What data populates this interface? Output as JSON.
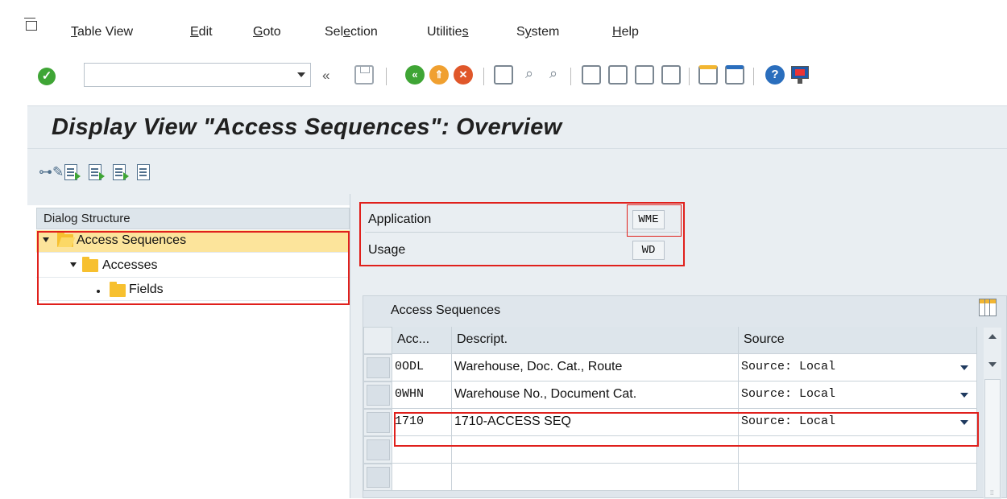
{
  "menu": {
    "items": [
      {
        "id": "table-view",
        "underline": "T",
        "rest": "able View"
      },
      {
        "id": "edit",
        "underline": "E",
        "rest": "dit"
      },
      {
        "id": "goto",
        "underline": "G",
        "rest": "oto"
      },
      {
        "id": "selection",
        "pre": "Sel",
        "underline": "e",
        "rest": "ction"
      },
      {
        "id": "utilities",
        "pre": "Utilitie",
        "underline": "s",
        "rest": ""
      },
      {
        "id": "system",
        "pre": "S",
        "underline": "y",
        "rest": "stem"
      },
      {
        "id": "help",
        "underline": "H",
        "rest": "elp"
      }
    ]
  },
  "toolbar": {
    "command_field": {
      "value": "",
      "placeholder": ""
    },
    "icons": [
      "enter-icon",
      "save-icon",
      "back-icon",
      "exit-icon",
      "cancel-icon",
      "print-icon",
      "find-icon",
      "find-next-icon",
      "first-page-icon",
      "previous-page-icon",
      "next-page-icon",
      "last-page-icon",
      "create-session-icon",
      "shortcut-icon",
      "help-icon",
      "customize-layout-icon"
    ]
  },
  "page": {
    "title": "Display View \"Access Sequences\": Overview"
  },
  "app_toolbar": {
    "icons": [
      "change-display-icon",
      "select-all-icon",
      "select-block-icon",
      "deselect-all-icon",
      "details-icon"
    ]
  },
  "dialog_structure": {
    "header": "Dialog Structure",
    "nodes": [
      {
        "label": "Access Sequences",
        "level": 0,
        "expanded": true,
        "selected": true
      },
      {
        "label": "Accesses",
        "level": 1,
        "expanded": true,
        "selected": false
      },
      {
        "label": "Fields",
        "level": 2,
        "expanded": false,
        "selected": false
      }
    ]
  },
  "header_fields": {
    "application": {
      "label": "Application",
      "value": "WME"
    },
    "usage": {
      "label": "Usage",
      "value": "WD"
    }
  },
  "table": {
    "title": "Access Sequences",
    "columns": [
      "Acc...",
      "Descript.",
      "Source"
    ],
    "rows": [
      {
        "acc": "0ODL",
        "descript": "Warehouse, Doc. Cat., Route",
        "source": "Source: Local"
      },
      {
        "acc": "0WHN",
        "descript": "Warehouse No., Document Cat.",
        "source": "Source: Local"
      },
      {
        "acc": "1710",
        "descript": "1710-ACCESS SEQ",
        "source": "Source: Local"
      },
      {
        "acc": "",
        "descript": "",
        "source": ""
      },
      {
        "acc": "",
        "descript": "",
        "source": ""
      }
    ]
  },
  "colors": {
    "highlight": "#e0201c",
    "selected_node": "#fce49b",
    "title_bar": "#e9eef2",
    "enter_green": "#3fa535"
  }
}
